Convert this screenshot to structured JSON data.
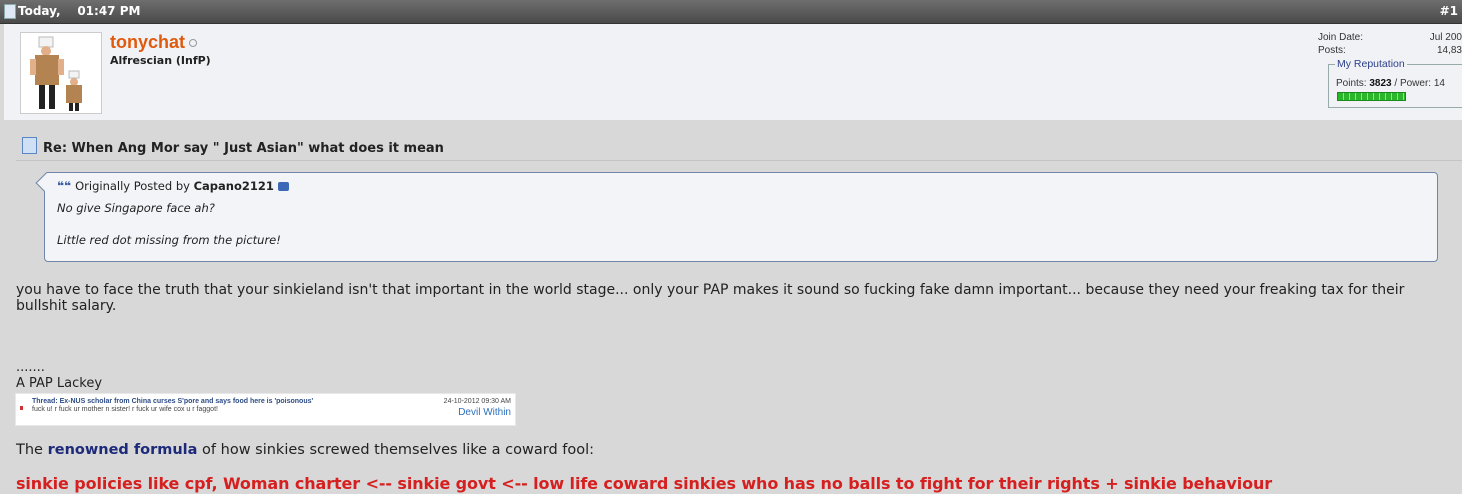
{
  "header": {
    "date": "Today,",
    "time": "01:47 PM",
    "post_number": "#1"
  },
  "user": {
    "name": "tonychat",
    "title": "Alfrescian (InfP)",
    "join_date_label": "Join Date:",
    "join_date_value": "Jul 200",
    "posts_label": "Posts:",
    "posts_value": "14,83",
    "reputation_legend": "My Reputation",
    "points_label": "Points:",
    "points_value": "3823",
    "power_label": "/ Power: 14"
  },
  "post": {
    "title": "Re: When Ang Mor say \" Just Asian\" what does it mean",
    "quote": {
      "prefix": "Originally Posted by",
      "author": "Capano2121",
      "lines": [
        "No give Singapore face ah?",
        "Little red dot missing from the picture!"
      ]
    },
    "body": "you have to face the truth that your sinkieland isn't that important in the world stage... only your PAP makes it sound so fucking fake damn important... because they need your freaking tax for their bullshit salary.",
    "signature": {
      "dots": ".......",
      "lackey": "A PAP Lackey",
      "image_thread": "Thread: Ex-NUS scholar from China curses S'pore and says food here is 'poisonous'",
      "image_quote": "fuck u! r fuck ur mother n sister! r fuck ur wife cox u r faggot!",
      "image_date": "24-10-2012 09:30 AM",
      "image_author": "Devil Within",
      "formula_pre": "The",
      "formula_link": "renowned formula",
      "formula_post": "of how sinkies screwed themselves like a coward fool:",
      "red_line": "sinkie policies like cpf, Woman charter <-- sinkie govt <-- low life coward sinkies who has no balls to fight for their rights + sinkie behaviour"
    }
  }
}
